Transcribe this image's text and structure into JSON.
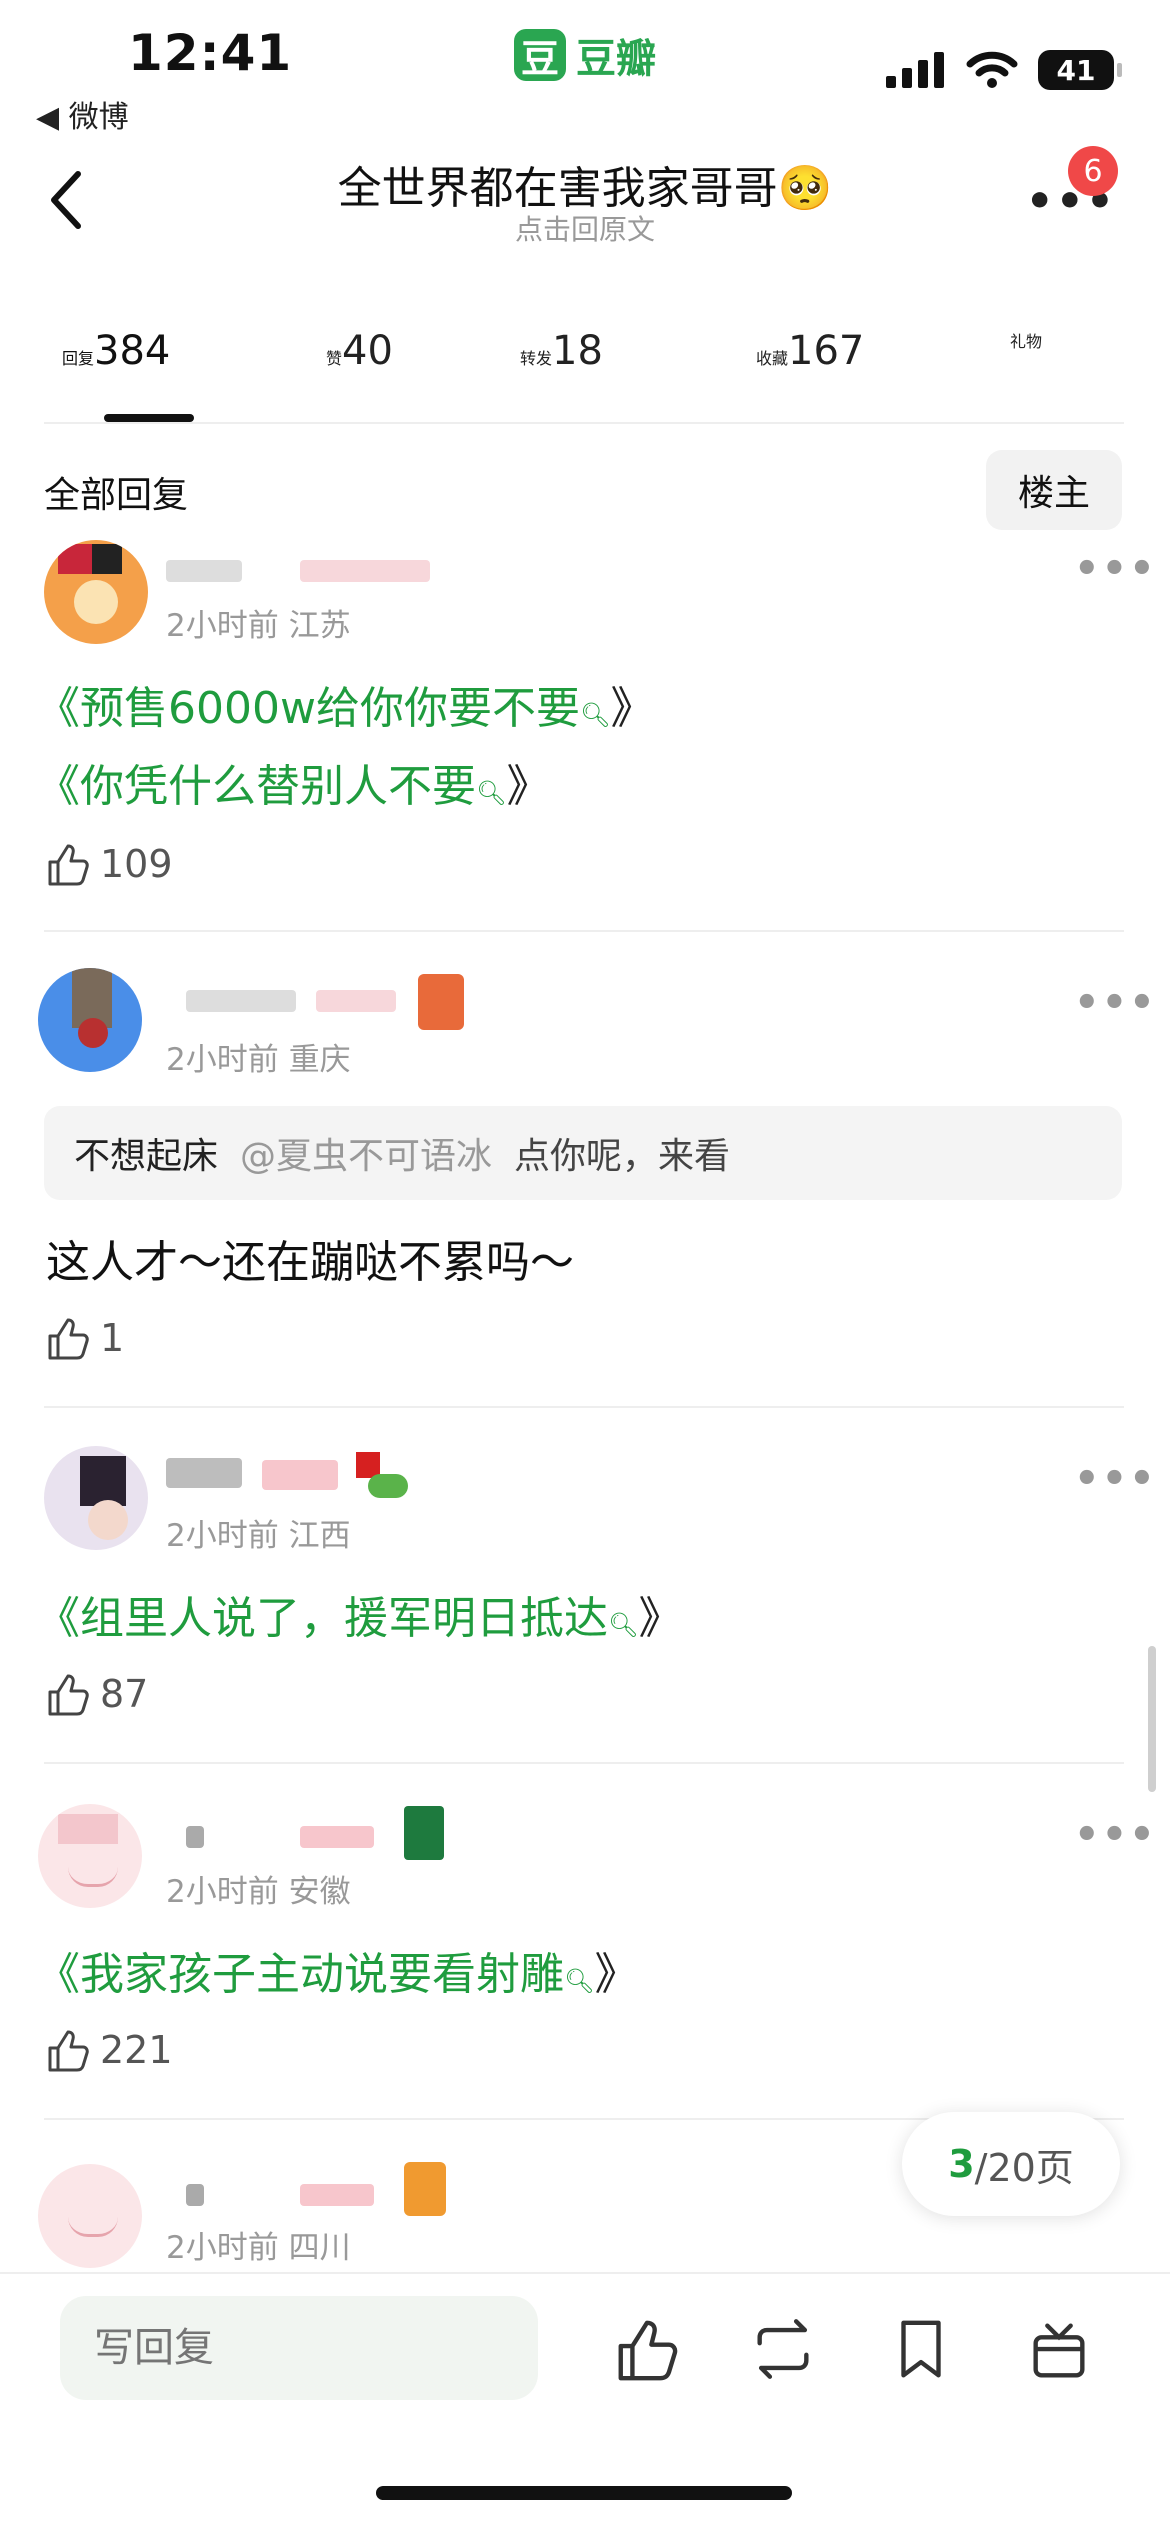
{
  "status_bar": {
    "time": "12:41",
    "back_app": "◀ 微博",
    "app_logo_char": "豆",
    "app_name": "豆瓣",
    "battery": "41"
  },
  "header": {
    "title": "全世界都在害我家哥哥🥺",
    "subtitle": "点击回原文",
    "more_badge": "6"
  },
  "tabs": [
    {
      "label": "回复",
      "count": "384"
    },
    {
      "label": "赞",
      "count": "40"
    },
    {
      "label": "转发",
      "count": "18"
    },
    {
      "label": "收藏",
      "count": "167"
    },
    {
      "label": "礼物",
      "count": ""
    }
  ],
  "filter": {
    "all_replies": "全部回复",
    "owner_only": "楼主"
  },
  "comments": [
    {
      "meta": "2小时前 江苏",
      "lines": [
        "《预售6000w给你你要不要",
        "《你凭什么替别人不要"
      ],
      "likes": "109"
    },
    {
      "meta": "2小时前 重庆",
      "quote_author": "不想起床",
      "quote_mention": "@夏虫不可语冰",
      "quote_text": "点你呢，来看",
      "text": "这人才～还在蹦哒不累吗～",
      "likes": "1"
    },
    {
      "meta": "2小时前 江西",
      "lines": [
        "《组里人说了，援军明日抵达"
      ],
      "likes": "87"
    },
    {
      "meta": "2小时前 安徽",
      "lines": [
        "《我家孩子主动说要看射雕"
      ],
      "likes": "221"
    },
    {
      "meta": "2小时前 四川"
    }
  ],
  "pagination": {
    "current": "3",
    "total_label": "/20页"
  },
  "bottom": {
    "reply_placeholder": "写回复"
  },
  "colors": {
    "accent": "#1f9c3e",
    "badge": "#f04848"
  }
}
